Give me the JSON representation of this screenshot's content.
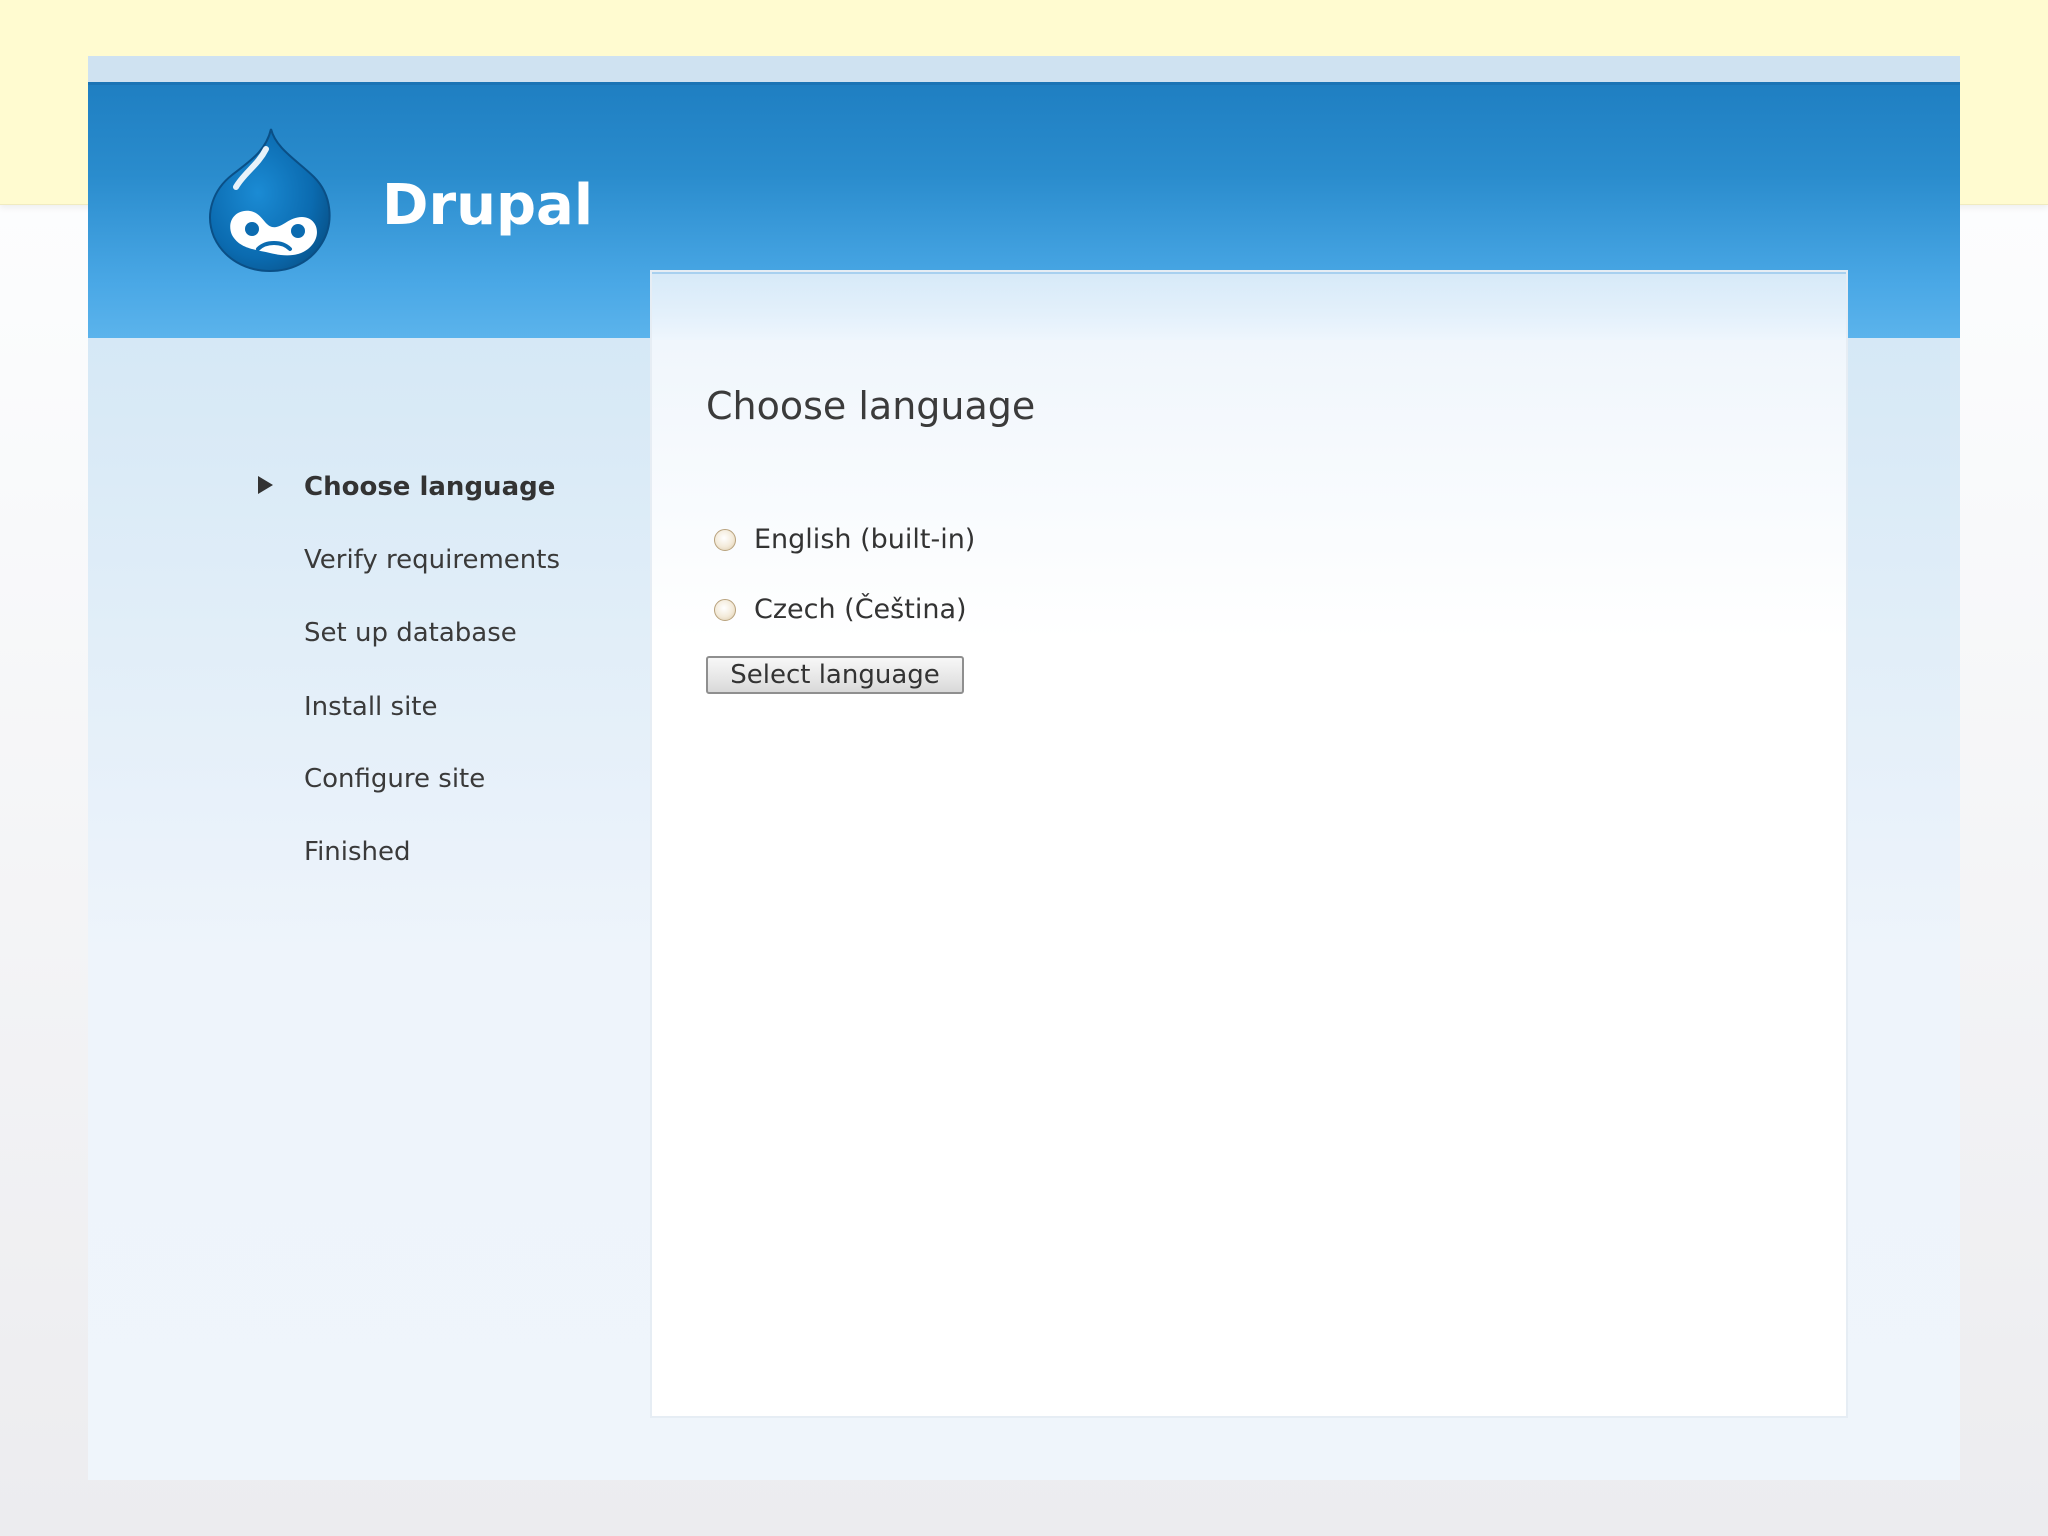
{
  "site": {
    "name": "Drupal"
  },
  "sidebar": {
    "items": [
      {
        "label": "Choose language",
        "active": true
      },
      {
        "label": "Verify requirements",
        "active": false
      },
      {
        "label": "Set up database",
        "active": false
      },
      {
        "label": "Install site",
        "active": false
      },
      {
        "label": "Configure site",
        "active": false
      },
      {
        "label": "Finished",
        "active": false
      }
    ]
  },
  "main": {
    "title": "Choose language",
    "options": [
      {
        "label": "English (built-in)",
        "selected": false
      },
      {
        "label": "Czech (Čeština)",
        "selected": false
      }
    ],
    "submit_label": "Select language"
  },
  "colors": {
    "header_blue": "#2a8ccd",
    "top_bar_yellow": "#fffbd0",
    "text": "#333333"
  },
  "icons": {
    "logo": "drupal-drop-logo",
    "active_marker": "triangle-right-icon"
  }
}
